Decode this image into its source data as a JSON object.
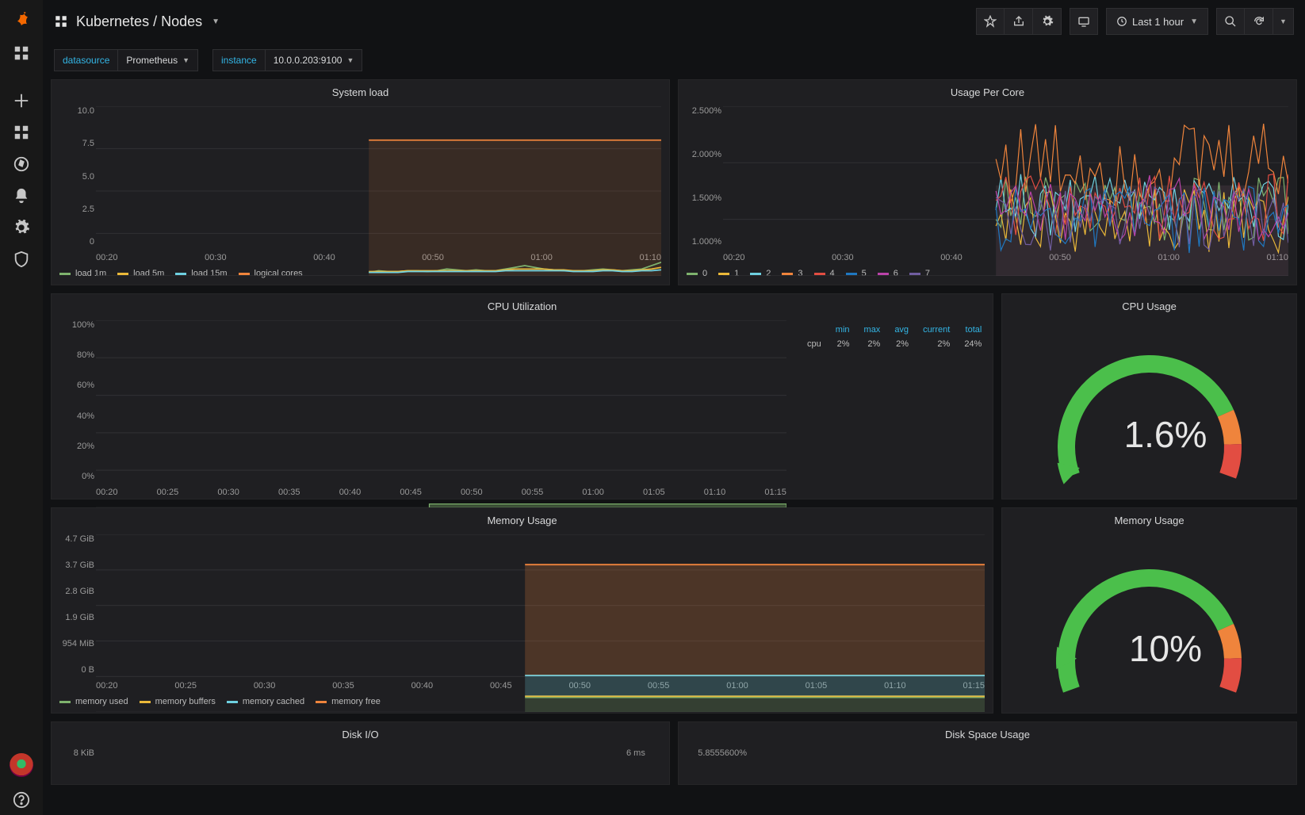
{
  "header": {
    "title": "Kubernetes / Nodes",
    "time_range": "Last 1 hour"
  },
  "vars": {
    "datasource": {
      "label": "datasource",
      "value": "Prometheus"
    },
    "instance": {
      "label": "instance",
      "value": "10.0.0.203:9100"
    }
  },
  "panels": {
    "system_load": {
      "title": "System load",
      "yticks": [
        "10.0",
        "7.5",
        "5.0",
        "2.5",
        "0"
      ],
      "xticks": [
        "00:20",
        "00:30",
        "00:40",
        "00:50",
        "01:00",
        "01:10"
      ],
      "legend": [
        {
          "label": "load 1m",
          "color": "#7EB26D"
        },
        {
          "label": "load 5m",
          "color": "#EAB839"
        },
        {
          "label": "load 15m",
          "color": "#6ED0E0"
        },
        {
          "label": "logical cores",
          "color": "#EF843C"
        }
      ]
    },
    "usage_per_core": {
      "title": "Usage Per Core",
      "yticks": [
        "2.500%",
        "2.000%",
        "1.500%",
        "1.000%"
      ],
      "xticks": [
        "00:20",
        "00:30",
        "00:40",
        "00:50",
        "01:00",
        "01:10"
      ],
      "legend": [
        {
          "label": "0",
          "color": "#7EB26D"
        },
        {
          "label": "1",
          "color": "#EAB839"
        },
        {
          "label": "2",
          "color": "#6ED0E0"
        },
        {
          "label": "3",
          "color": "#EF843C"
        },
        {
          "label": "4",
          "color": "#E24D42"
        },
        {
          "label": "5",
          "color": "#1F78C1"
        },
        {
          "label": "6",
          "color": "#BA43A9"
        },
        {
          "label": "7",
          "color": "#705DA0"
        }
      ]
    },
    "cpu_util": {
      "title": "CPU Utilization",
      "yticks": [
        "100%",
        "80%",
        "60%",
        "40%",
        "20%",
        "0%"
      ],
      "xticks": [
        "00:20",
        "00:25",
        "00:30",
        "00:35",
        "00:40",
        "00:45",
        "00:50",
        "00:55",
        "01:00",
        "01:05",
        "01:10",
        "01:15"
      ],
      "legend_header": [
        "min",
        "max",
        "avg",
        "current",
        "total"
      ],
      "legend_rows": [
        {
          "label": "cpu",
          "color": "#7EB26D",
          "min": "2%",
          "max": "2%",
          "avg": "2%",
          "current": "2%",
          "total": "24%"
        }
      ]
    },
    "cpu_gauge": {
      "title": "CPU Usage",
      "value": "1.6%"
    },
    "mem_usage": {
      "title": "Memory Usage",
      "yticks": [
        "4.7 GiB",
        "3.7 GiB",
        "2.8 GiB",
        "1.9 GiB",
        "954 MiB",
        "0 B"
      ],
      "xticks": [
        "00:20",
        "00:25",
        "00:30",
        "00:35",
        "00:40",
        "00:45",
        "00:50",
        "00:55",
        "01:00",
        "01:05",
        "01:10",
        "01:15"
      ],
      "legend": [
        {
          "label": "memory used",
          "color": "#7EB26D"
        },
        {
          "label": "memory buffers",
          "color": "#EAB839"
        },
        {
          "label": "memory cached",
          "color": "#6ED0E0"
        },
        {
          "label": "memory free",
          "color": "#EF843C"
        }
      ]
    },
    "mem_gauge": {
      "title": "Memory Usage",
      "value": "10%"
    },
    "disk_io": {
      "title": "Disk I/O",
      "ylabels_left": [
        "8 KiB"
      ],
      "ylabels_right": [
        "6 ms"
      ]
    },
    "disk_space": {
      "title": "Disk Space Usage",
      "ylabels_left": [
        "5.8555600%"
      ]
    }
  },
  "chart_data": [
    {
      "id": "system_load",
      "type": "line",
      "title": "System load",
      "xlabel": "",
      "ylabel": "",
      "ylim": [
        0,
        10
      ],
      "x_range_minutes": [
        20,
        78
      ],
      "data_start_minute": 48,
      "series": [
        {
          "name": "load 1m",
          "color": "#7EB26D",
          "values": [
            0.2,
            0.3,
            0.25,
            0.25,
            0.3,
            0.3,
            0.25,
            0.3,
            0.4,
            0.35,
            0.3,
            0.35,
            0.3,
            0.3,
            0.4,
            0.5,
            0.6,
            0.5,
            0.4,
            0.35,
            0.3,
            0.3,
            0.3,
            0.35,
            0.4,
            0.35,
            0.3,
            0.35,
            0.4,
            0.6,
            0.8
          ]
        },
        {
          "name": "load 5m",
          "color": "#EAB839",
          "values": [
            0.25,
            0.25,
            0.25,
            0.25,
            0.3,
            0.3,
            0.3,
            0.3,
            0.3,
            0.3,
            0.3,
            0.3,
            0.3,
            0.3,
            0.35,
            0.4,
            0.4,
            0.4,
            0.4,
            0.35,
            0.35,
            0.3,
            0.3,
            0.3,
            0.35,
            0.35,
            0.3,
            0.3,
            0.35,
            0.4,
            0.5
          ]
        },
        {
          "name": "load 15m",
          "color": "#6ED0E0",
          "values": [
            0.2,
            0.2,
            0.2,
            0.2,
            0.25,
            0.25,
            0.25,
            0.25,
            0.25,
            0.25,
            0.25,
            0.25,
            0.25,
            0.25,
            0.3,
            0.3,
            0.3,
            0.3,
            0.3,
            0.3,
            0.3,
            0.25,
            0.25,
            0.25,
            0.3,
            0.3,
            0.25,
            0.25,
            0.3,
            0.3,
            0.35
          ]
        },
        {
          "name": "logical cores",
          "color": "#EF843C",
          "values": [
            8,
            8,
            8,
            8,
            8,
            8,
            8,
            8,
            8,
            8,
            8,
            8,
            8,
            8,
            8,
            8,
            8,
            8,
            8,
            8,
            8,
            8,
            8,
            8,
            8,
            8,
            8,
            8,
            8,
            8,
            8
          ]
        }
      ],
      "fill_area_top_value": 8,
      "fill_area_color": "rgba(239,132,60,0.12)"
    },
    {
      "id": "usage_per_core",
      "type": "line",
      "title": "Usage Per Core",
      "xlabel": "",
      "ylabel": "",
      "ylim": [
        1.0,
        2.5
      ],
      "y_unit": "%",
      "x_range_minutes": [
        20,
        78
      ],
      "data_start_minute": 48,
      "note": "8 noisy cpu-percent series oscillating roughly between 1.2% and 2.4%",
      "series": [
        {
          "name": "0",
          "color": "#7EB26D",
          "range": [
            1.3,
            1.9
          ]
        },
        {
          "name": "1",
          "color": "#EAB839",
          "range": [
            1.2,
            1.8
          ]
        },
        {
          "name": "2",
          "color": "#6ED0E0",
          "range": [
            1.3,
            1.9
          ]
        },
        {
          "name": "3",
          "color": "#EF843C",
          "range": [
            1.6,
            2.4
          ]
        },
        {
          "name": "4",
          "color": "#E24D42",
          "range": [
            1.3,
            1.9
          ]
        },
        {
          "name": "5",
          "color": "#1F78C1",
          "range": [
            1.2,
            1.8
          ]
        },
        {
          "name": "6",
          "color": "#BA43A9",
          "range": [
            1.3,
            1.9
          ]
        },
        {
          "name": "7",
          "color": "#705DA0",
          "range": [
            1.2,
            1.8
          ]
        }
      ]
    },
    {
      "id": "cpu_util",
      "type": "area",
      "title": "CPU Utilization",
      "xlabel": "",
      "ylabel": "",
      "ylim": [
        0,
        100
      ],
      "y_unit": "%",
      "x_range_minutes": [
        20,
        78
      ],
      "data_start_minute": 48,
      "series": [
        {
          "name": "cpu",
          "color": "#7EB26D",
          "values": [
            2,
            2,
            2,
            2,
            2,
            2,
            2,
            2,
            2,
            2,
            2,
            2,
            2,
            2,
            2,
            2,
            2,
            2,
            2,
            2,
            2,
            2,
            2,
            2,
            2,
            2,
            2,
            2,
            2,
            2,
            2
          ]
        }
      ]
    },
    {
      "id": "cpu_gauge",
      "type": "gauge",
      "title": "CPU Usage",
      "value": 1.6,
      "unit": "%",
      "min": 0,
      "max": 100,
      "thresholds": [
        {
          "to": 80,
          "color": "#4bbf4b"
        },
        {
          "to": 90,
          "color": "#EF843C"
        },
        {
          "to": 100,
          "color": "#E24D42"
        }
      ]
    },
    {
      "id": "mem_usage",
      "type": "area_stacked",
      "title": "Memory Usage",
      "xlabel": "",
      "ylabel": "",
      "ylim_gib": [
        0,
        4.7
      ],
      "x_range_minutes": [
        20,
        78
      ],
      "data_start_minute": 48,
      "stacked_top_gib": 3.9,
      "series_constant_gib": [
        {
          "name": "memory used",
          "color": "#7EB26D",
          "value": 0.39
        },
        {
          "name": "memory buffers",
          "color": "#EAB839",
          "value": 0.03
        },
        {
          "name": "memory cached",
          "color": "#6ED0E0",
          "value": 0.55
        },
        {
          "name": "memory free",
          "color": "#EF843C",
          "value": 2.93
        }
      ]
    },
    {
      "id": "mem_gauge",
      "type": "gauge",
      "title": "Memory Usage",
      "value": 10,
      "unit": "%",
      "min": 0,
      "max": 100,
      "thresholds": [
        {
          "to": 80,
          "color": "#4bbf4b"
        },
        {
          "to": 90,
          "color": "#EF843C"
        },
        {
          "to": 100,
          "color": "#E24D42"
        }
      ]
    }
  ]
}
